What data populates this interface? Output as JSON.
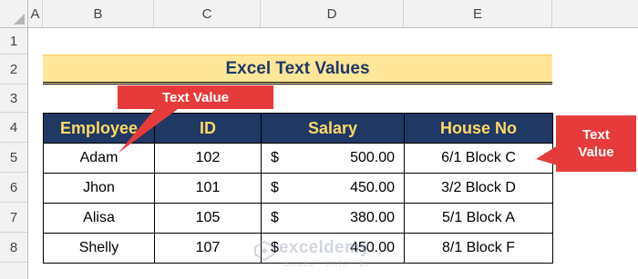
{
  "sheet": {
    "columns": [
      "A",
      "B",
      "C",
      "D",
      "E"
    ],
    "rows": [
      "1",
      "2",
      "3",
      "4",
      "5",
      "6",
      "7",
      "8"
    ]
  },
  "title": "Excel Text Values",
  "table": {
    "headers": [
      "Employee",
      "ID",
      "Salary",
      "House No"
    ],
    "rows": [
      {
        "employee": "Adam",
        "id": "102",
        "currency": "$",
        "salary": "500.00",
        "house": "6/1 Block C"
      },
      {
        "employee": "Jhon",
        "id": "101",
        "currency": "$",
        "salary": "450.00",
        "house": "3/2 Block D"
      },
      {
        "employee": "Alisa",
        "id": "105",
        "currency": "$",
        "salary": "380.00",
        "house": "5/1 Block A"
      },
      {
        "employee": "Shelly",
        "id": "107",
        "currency": "$",
        "salary": "450.00",
        "house": "8/1 Block F"
      }
    ]
  },
  "callouts": {
    "first": "Text Value",
    "second_line1": "Text",
    "second_line2": "Value"
  },
  "watermark": {
    "name": "exceldemy",
    "tagline": "EXCEL · DATA · BI"
  },
  "colors": {
    "header_fill": "#1f3864",
    "header_text": "#ffd966",
    "title_fill": "#ffe699",
    "callout": "#e63b3b"
  }
}
